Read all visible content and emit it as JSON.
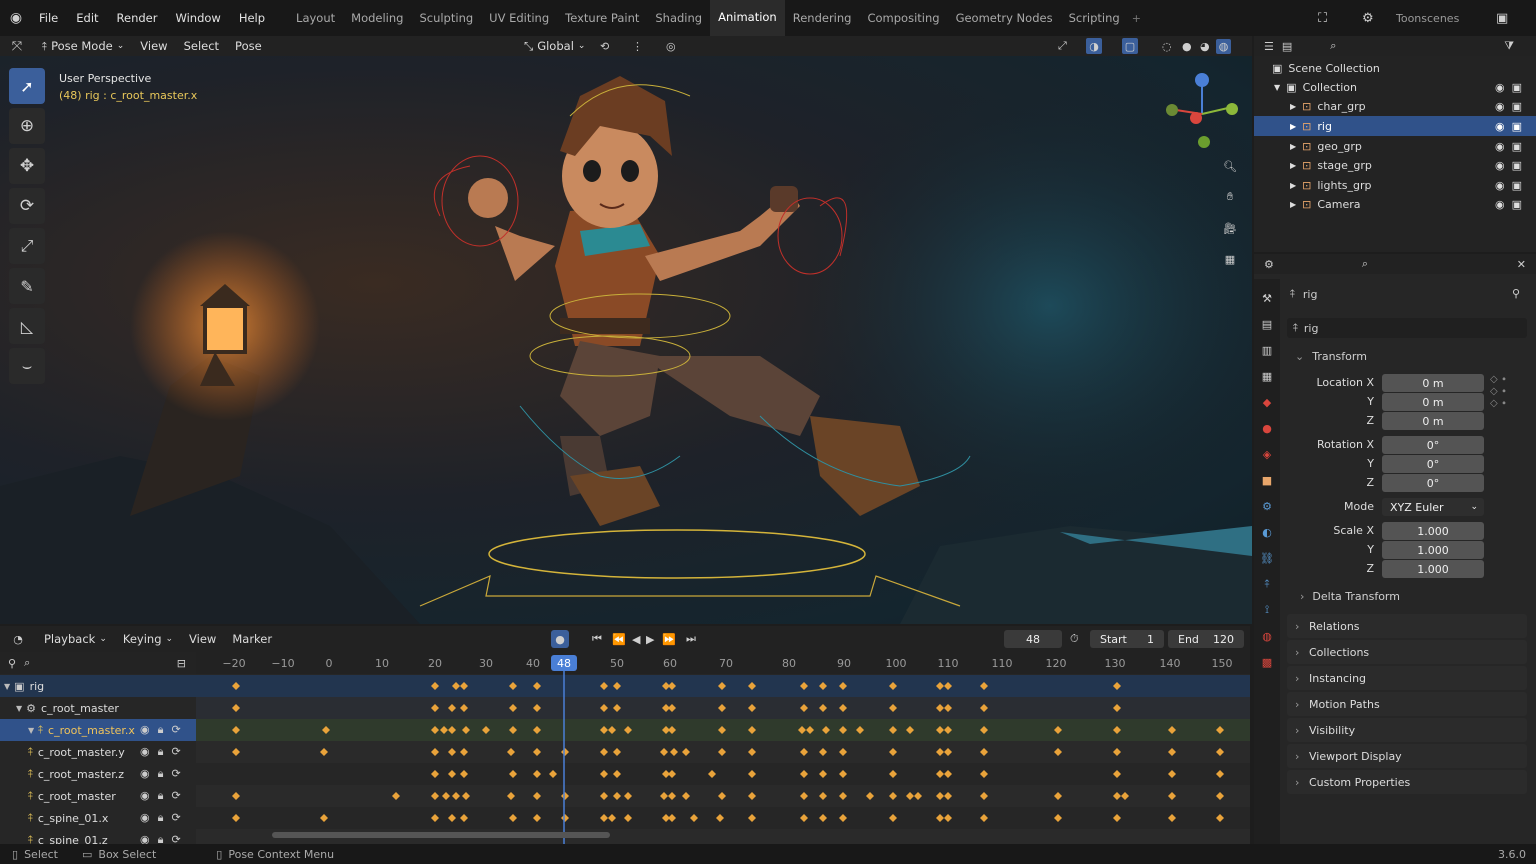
{
  "menu": [
    "File",
    "Edit",
    "Render",
    "Window",
    "Help"
  ],
  "workspaces": [
    "Layout",
    "Modeling",
    "Sculpting",
    "UV Editing",
    "Texture Paint",
    "Shading",
    "Animation",
    "Rendering",
    "Compositing",
    "Geometry Nodes",
    "Scripting"
  ],
  "active_workspace": "Animation",
  "scene_name": "Toonscenes",
  "viewport_header": {
    "mode": "Pose Mode",
    "view": "View",
    "select": "Select",
    "pose": "Pose",
    "orientation": "Global"
  },
  "viewport_info": {
    "perspective": "User Perspective",
    "active": "(48) rig : c_root_master.x"
  },
  "outliner": {
    "root": "Scene Collection",
    "collection": "Collection",
    "items": [
      "char_grp",
      "rig",
      "geo_grp",
      "stage_grp",
      "lights_grp",
      "Camera"
    ],
    "selected": "rig"
  },
  "properties": {
    "object": "rig",
    "data": "rig",
    "transform_label": "Transform",
    "location": {
      "label_x": "Location X",
      "label_y": "Y",
      "label_z": "Z",
      "x": "0 m",
      "y": "0 m",
      "z": "0 m"
    },
    "rotation": {
      "label_x": "Rotation X",
      "label_y": "Y",
      "label_z": "Z",
      "x": "0°",
      "y": "0°",
      "z": "0°"
    },
    "mode_label": "Mode",
    "mode": "XYZ Euler",
    "scale": {
      "label_x": "Scale X",
      "label_y": "Y",
      "label_z": "Z",
      "x": "1.000",
      "y": "1.000",
      "z": "1.000"
    },
    "delta": "Delta Transform",
    "panels": [
      "Relations",
      "Collections",
      "Instancing",
      "Motion Paths",
      "Visibility",
      "Viewport Display",
      "Custom Properties"
    ]
  },
  "timeline": {
    "playback": "Playback",
    "keying": "Keying",
    "view": "View",
    "marker": "Marker",
    "current_frame": "48",
    "start_label": "Start",
    "start": "1",
    "end_label": "End",
    "end": "120",
    "ruler": [
      "−20",
      "−10",
      "0",
      "10",
      "20",
      "30",
      "40",
      "48",
      "50",
      "60",
      "70",
      "80",
      "90",
      "100",
      "110",
      "110",
      "120",
      "130",
      "140",
      "150"
    ]
  },
  "channels": [
    "rig",
    "c_root_master",
    "c_root_master.x",
    "c_root_master.y",
    "c_root_master.z",
    "c_root_master",
    "c_spine_01.x",
    "c_spine_01.z"
  ],
  "status": {
    "select": "Select",
    "box_select": "Box Select",
    "context": "Pose Context Menu",
    "version": "3.6.0"
  },
  "colors": {
    "accent": "#3b5f9b",
    "selection": "#30528a",
    "keyframe": "#e9a33a",
    "playhead": "#4a7fd6",
    "info_yellow": "#e8c75a"
  }
}
